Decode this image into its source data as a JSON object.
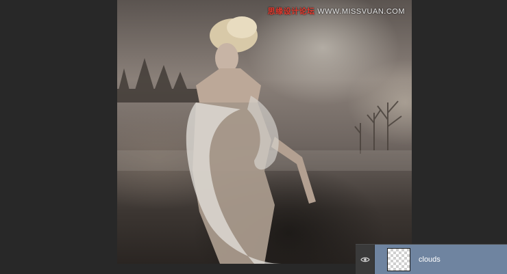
{
  "watermark": {
    "cn_text": "思缘设计论坛",
    "url_text": "WWW.MISSVUAN.COM"
  },
  "layers_panel": {
    "layer": {
      "name": "clouds",
      "visible": true,
      "visibility_icon": "eye-icon",
      "thumbnail": "transparent-checkerboard"
    },
    "selected_color": "#6f84a0"
  },
  "canvas": {
    "content": "photo-composite"
  }
}
